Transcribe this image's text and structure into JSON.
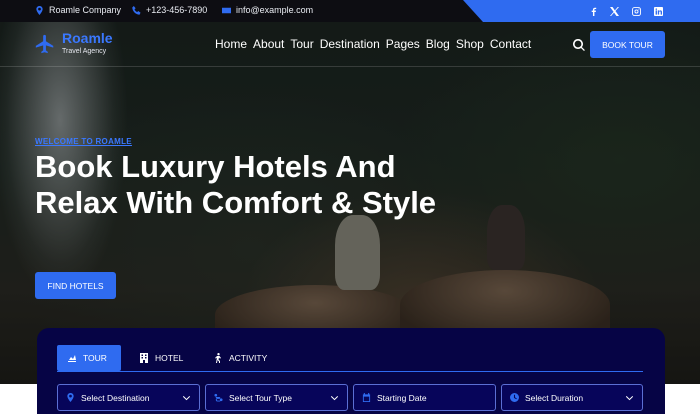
{
  "topbar": {
    "company": "Roamle Company",
    "phone": "+123-456-7890",
    "email": "info@example.com",
    "social": [
      "facebook-icon",
      "x-icon",
      "instagram-icon",
      "linkedin-icon"
    ]
  },
  "brand": {
    "name": "Roamle",
    "tagline": "Travel Agency",
    "accent": "#2f6bf0"
  },
  "nav": {
    "items": [
      "Home",
      "About",
      "Tour",
      "Destination",
      "Pages",
      "Blog",
      "Shop",
      "Contact"
    ],
    "cta": "BOOK TOUR"
  },
  "hero": {
    "eyebrow": "WELCOME TO ROAMLE",
    "headline": "Book Luxury Hotels And Relax With Comfort & Style",
    "button": "FIND HOTELS"
  },
  "search": {
    "tabs": [
      {
        "label": "TOUR",
        "icon": "tour-icon",
        "active": true
      },
      {
        "label": "HOTEL",
        "icon": "hotel-icon",
        "active": false
      },
      {
        "label": "ACTIVITY",
        "icon": "activity-icon",
        "active": false
      }
    ],
    "fields": [
      {
        "label": "Select Destination",
        "icon": "location-pin-icon"
      },
      {
        "label": "Select Tour Type",
        "icon": "route-icon"
      },
      {
        "label": "Starting Date",
        "icon": "calendar-icon"
      },
      {
        "label": "Select Duration",
        "icon": "clock-icon"
      }
    ]
  }
}
